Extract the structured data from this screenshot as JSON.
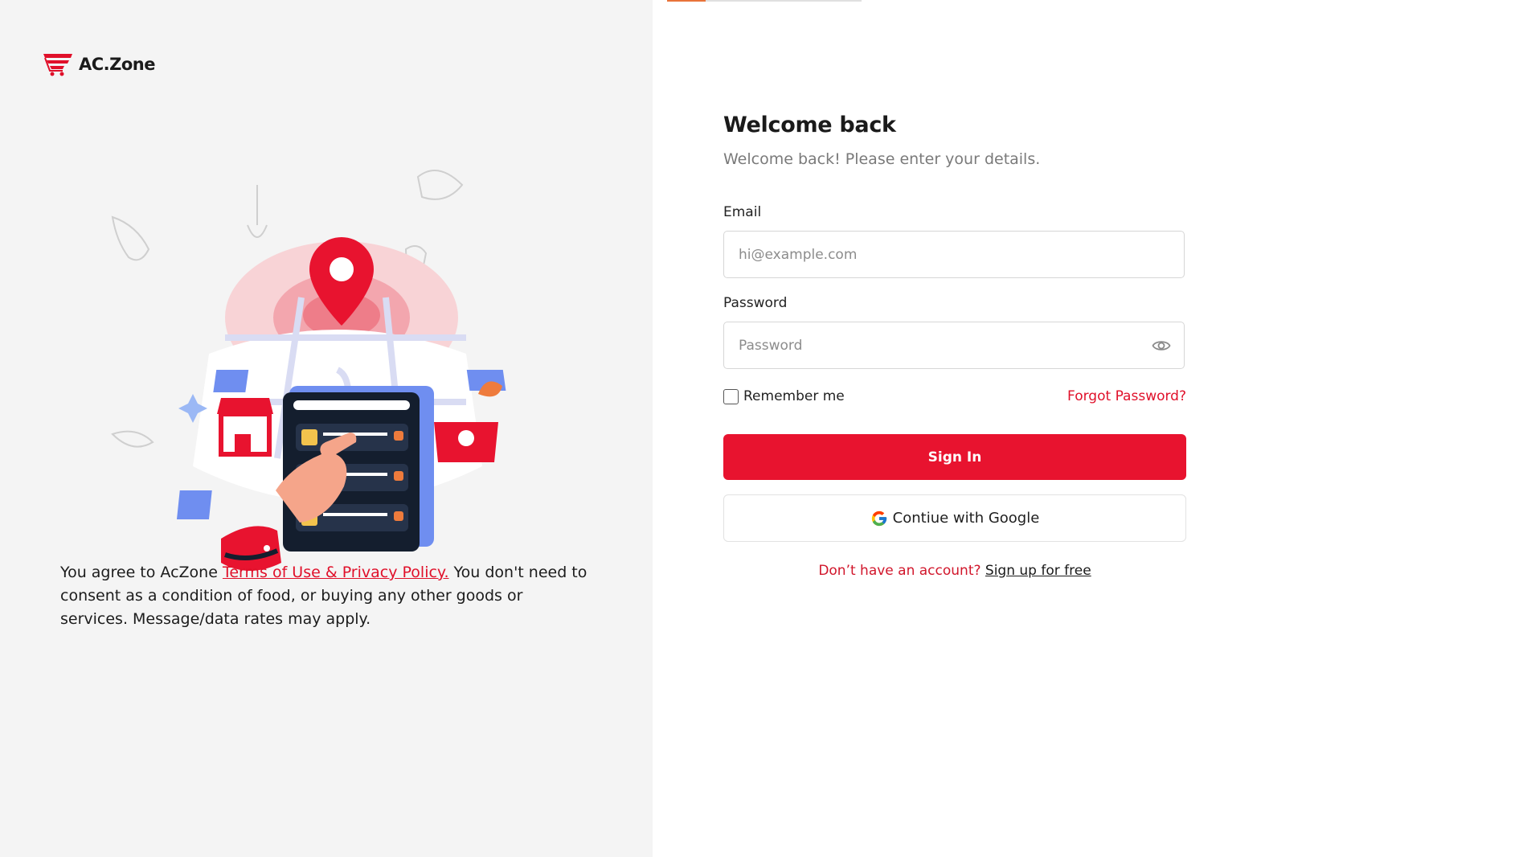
{
  "brand": {
    "name": "AC.Zone",
    "color": "#e0102a"
  },
  "progress": {
    "value": 0.2,
    "accent": "#e8733a"
  },
  "terms": {
    "prefix": "You agree to AcZone ",
    "link": "Terms of Use & Privacy Policy.",
    "suffix": " You don't need to consent as a condition of food, or buying any other goods or services. Message/data rates may apply."
  },
  "form": {
    "title": "Welcome back",
    "subtitle": "Welcome back! Please enter your details.",
    "email": {
      "label": "Email",
      "placeholder": "hi@example.com",
      "value": ""
    },
    "password": {
      "label": "Password",
      "placeholder": "Password",
      "value": "",
      "toggle_icon": "eye-icon"
    },
    "remember": {
      "label": "Remember me",
      "checked": false
    },
    "forgot": "Forgot Password?",
    "signin": "Sign In",
    "google": {
      "label": "Contiue with Google",
      "icon": "google-icon"
    },
    "signup": {
      "question": "Don’t have an account?",
      "link": "Sign up for free"
    }
  },
  "colors": {
    "primary": "#e8132f",
    "panel_bg": "#f4f4f4"
  }
}
